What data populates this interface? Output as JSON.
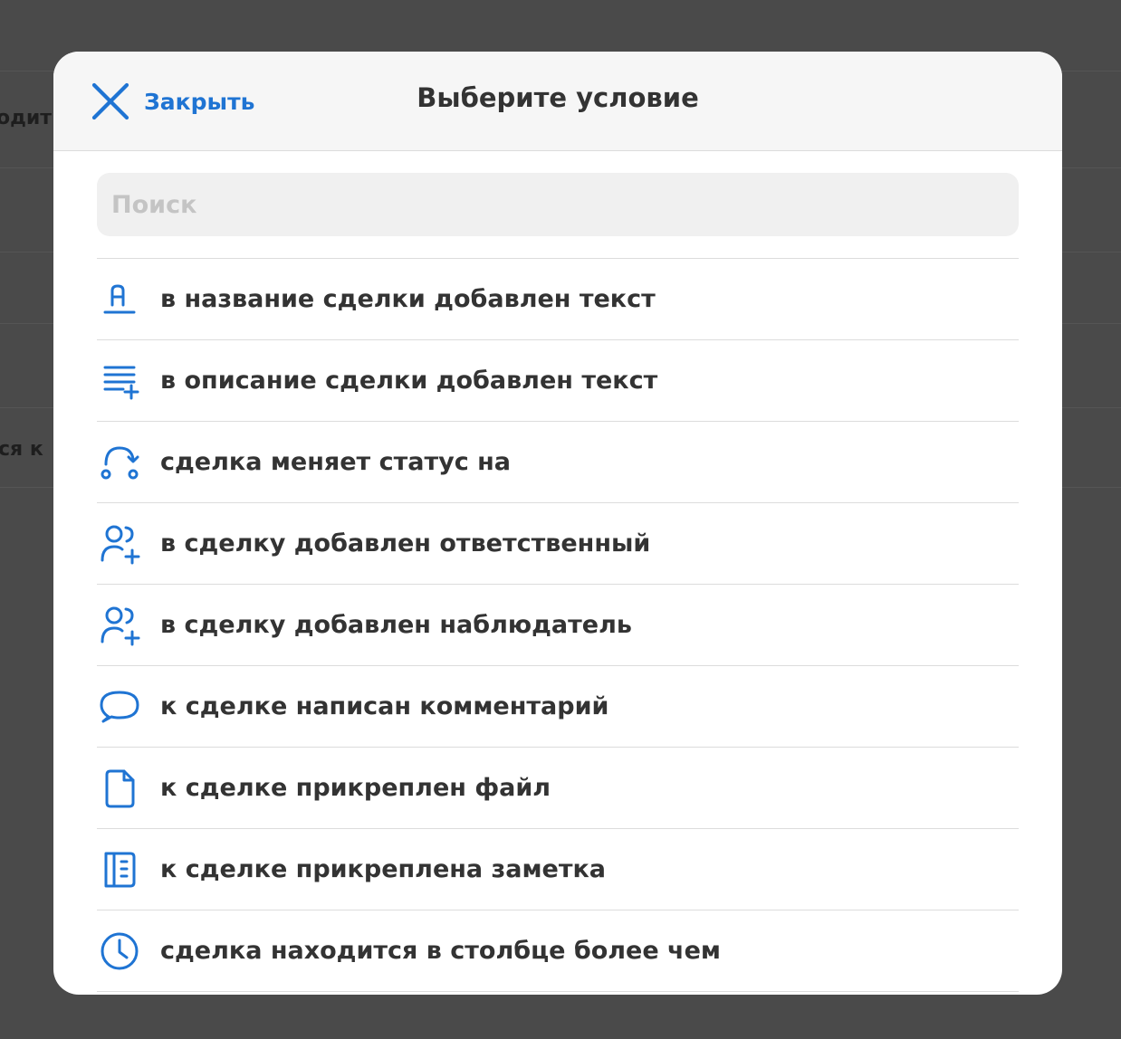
{
  "background": {
    "fragments": [
      "одит",
      "ся к"
    ]
  },
  "modal": {
    "close_label": "Закрыть",
    "title": "Выберите условие",
    "search_placeholder": "Поиск"
  },
  "conditions": [
    {
      "label": "в название сделки добавлен текст",
      "icon": "text-title-icon"
    },
    {
      "label": "в описание сделки добавлен текст",
      "icon": "text-add-icon"
    },
    {
      "label": "сделка меняет статус на",
      "icon": "status-change-icon"
    },
    {
      "label": "в сделку добавлен ответственный",
      "icon": "add-users-icon"
    },
    {
      "label": "в сделку добавлен наблюдатель",
      "icon": "add-users-icon"
    },
    {
      "label": "к сделке написан комментарий",
      "icon": "comment-icon"
    },
    {
      "label": "к сделке прикреплен файл",
      "icon": "file-icon"
    },
    {
      "label": "к сделке прикреплена заметка",
      "icon": "note-icon"
    },
    {
      "label": "сделка находится в столбце более чем",
      "icon": "clock-icon"
    }
  ],
  "colors": {
    "accent": "#1f74d3",
    "overlay": "#4a4a4a",
    "text": "#333333"
  }
}
